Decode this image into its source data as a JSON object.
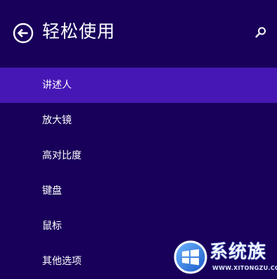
{
  "header": {
    "title": "轻松使用",
    "back_icon": "back-arrow-icon",
    "search_icon": "search-icon"
  },
  "menu": {
    "items": [
      {
        "label": "讲述人",
        "selected": true
      },
      {
        "label": "放大镜",
        "selected": false
      },
      {
        "label": "高对比度",
        "selected": false
      },
      {
        "label": "键盘",
        "selected": false
      },
      {
        "label": "鼠标",
        "selected": false
      },
      {
        "label": "其他选项",
        "selected": false
      }
    ]
  },
  "watermark": {
    "title": "系统族",
    "url": "WWW.XITONGZU.COM",
    "logo_icon": "windows-logo-icon"
  },
  "colors": {
    "background": "#18005a",
    "selected_item": "#4617b4",
    "text": "#ffffff"
  }
}
